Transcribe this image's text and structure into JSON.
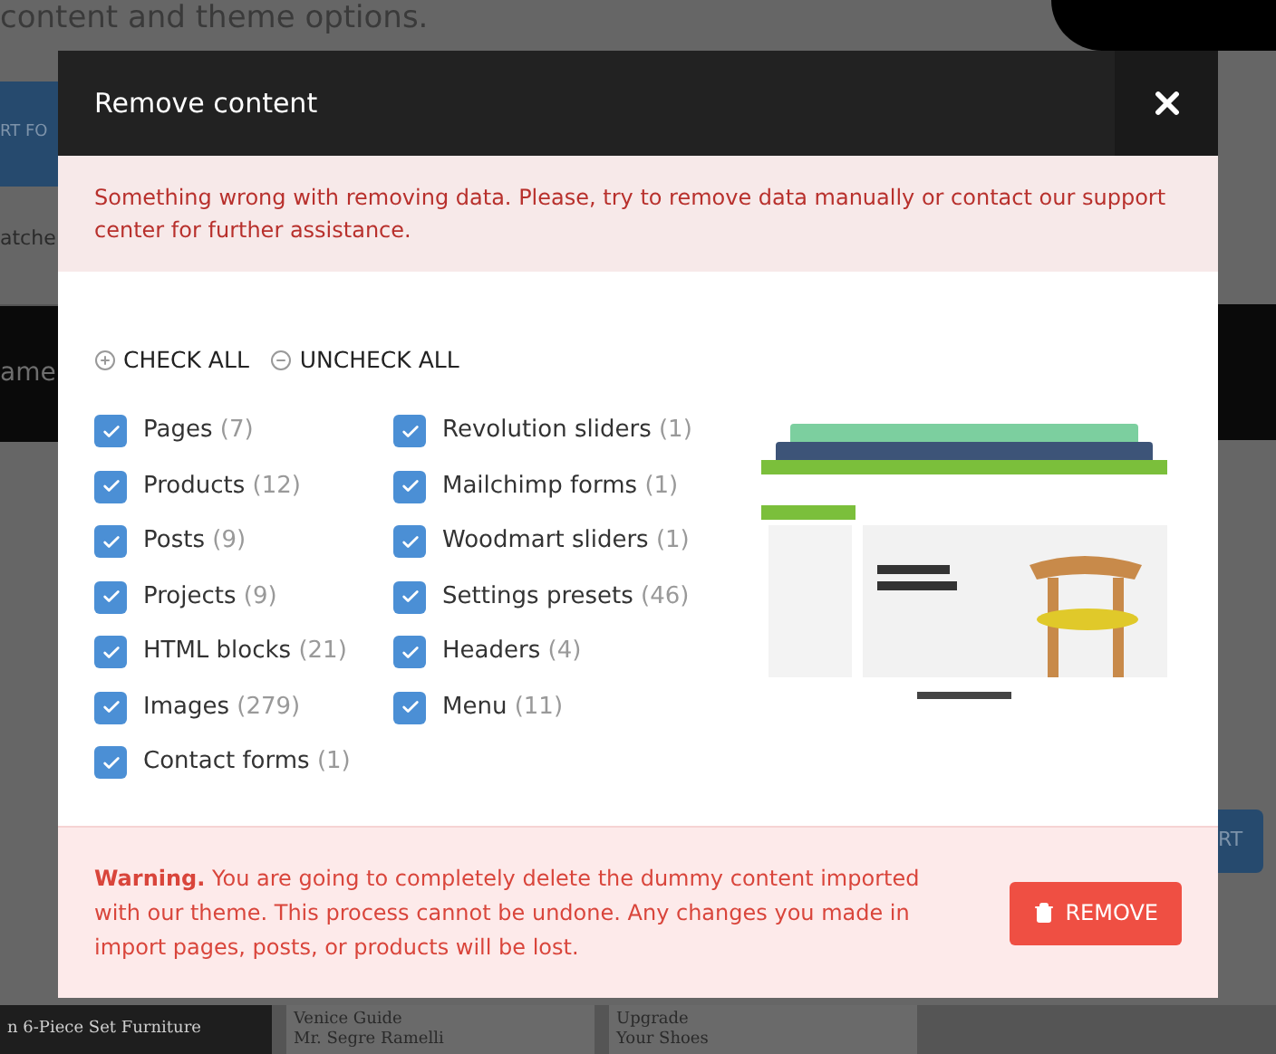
{
  "backdrop": {
    "heading": "content and theme options.",
    "left_button": "RT FO",
    "left_tab": "atche",
    "band_text": "ame",
    "right_button": "RT",
    "tiles": [
      {
        "lines": [
          "n 6-Piece Set Furniture"
        ]
      },
      {
        "lines": [
          "Venice Guide",
          "Mr. Segre Ramelli"
        ]
      },
      {
        "lines": [
          "Upgrade",
          "Your Shoes"
        ]
      }
    ]
  },
  "dialog": {
    "title": "Remove content",
    "error": "Something wrong with removing data. Please, try to remove data manually or contact our support center for further assistance.",
    "check_all": "CHECK ALL",
    "uncheck_all": "UNCHECK ALL",
    "columns": [
      [
        {
          "label": "Pages",
          "count": "(7)",
          "checked": true
        },
        {
          "label": "Products",
          "count": "(12)",
          "checked": true
        },
        {
          "label": "Posts",
          "count": "(9)",
          "checked": true
        },
        {
          "label": "Projects",
          "count": "(9)",
          "checked": true
        },
        {
          "label": "HTML blocks",
          "count": "(21)",
          "checked": true
        },
        {
          "label": "Images",
          "count": "(279)",
          "checked": true
        },
        {
          "label": "Contact forms",
          "count": "(1)",
          "checked": true
        }
      ],
      [
        {
          "label": "Revolution sliders",
          "count": "(1)",
          "checked": true
        },
        {
          "label": "Mailchimp forms",
          "count": "(1)",
          "checked": true
        },
        {
          "label": "Woodmart sliders",
          "count": "(1)",
          "checked": true
        },
        {
          "label": "Settings presets",
          "count": "(46)",
          "checked": true
        },
        {
          "label": "Headers",
          "count": "(4)",
          "checked": true
        },
        {
          "label": "Menu",
          "count": "(11)",
          "checked": true
        }
      ]
    ],
    "preview": {
      "kind": "picture"
    },
    "warning": "**Warning.** You are going to completely delete the dummy content imported with our theme. This process cannot be undone. Any changes you made in import pages, posts, or products will be lost.",
    "remove_button": "REMOVE"
  }
}
